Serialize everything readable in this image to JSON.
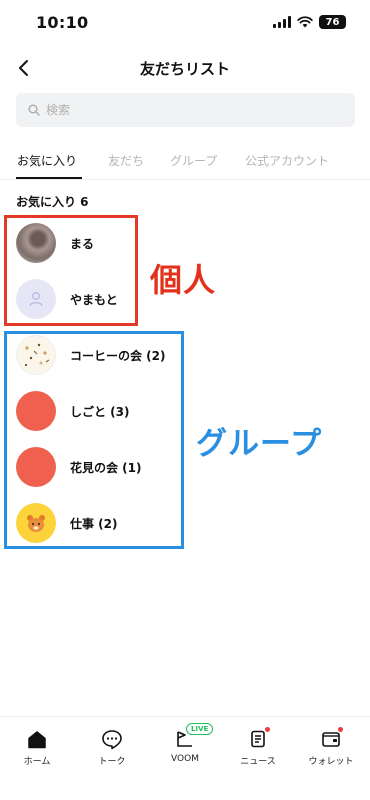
{
  "status_bar": {
    "time": "10:10",
    "battery": "76"
  },
  "header": {
    "title": "友だちリスト",
    "back_icon": "chevron-left-icon"
  },
  "search": {
    "placeholder": "検索",
    "icon": "search-icon"
  },
  "tabs": [
    {
      "label": "お気に入り",
      "active": true
    },
    {
      "label": "友だち",
      "active": false
    },
    {
      "label": "グループ",
      "active": false
    },
    {
      "label": "公式アカウント",
      "active": false
    }
  ],
  "section": {
    "label": "お気に入り 6"
  },
  "individuals": [
    {
      "name": "まる",
      "avatar": "photo-avatar"
    },
    {
      "name": "やまもと",
      "avatar": "default-person-icon"
    }
  ],
  "groups": [
    {
      "name": "コーヒーの会 (2)",
      "avatar": "coffee-pattern-avatar"
    },
    {
      "name": "しごと (3)",
      "avatar": "red-circle-avatar",
      "color": "#f0604f"
    },
    {
      "name": "花見の会 (1)",
      "avatar": "red-circle-avatar",
      "color": "#f0604f"
    },
    {
      "name": "仕事 (2)",
      "avatar": "bear-avatar",
      "color": "#fcd33b"
    }
  ],
  "annotations": {
    "individual_label": "個人",
    "group_label": "グループ",
    "individual_color": "#e23a26",
    "group_color": "#2a8fe0"
  },
  "bottom_nav": [
    {
      "label": "ホーム",
      "icon": "home-icon",
      "active": true
    },
    {
      "label": "トーク",
      "icon": "chat-icon",
      "active": false
    },
    {
      "label": "VOOM",
      "icon": "voom-icon",
      "badge": "LIVE"
    },
    {
      "label": "ニュース",
      "icon": "news-icon",
      "dot": true
    },
    {
      "label": "ウォレット",
      "icon": "wallet-icon",
      "dot": true
    }
  ]
}
